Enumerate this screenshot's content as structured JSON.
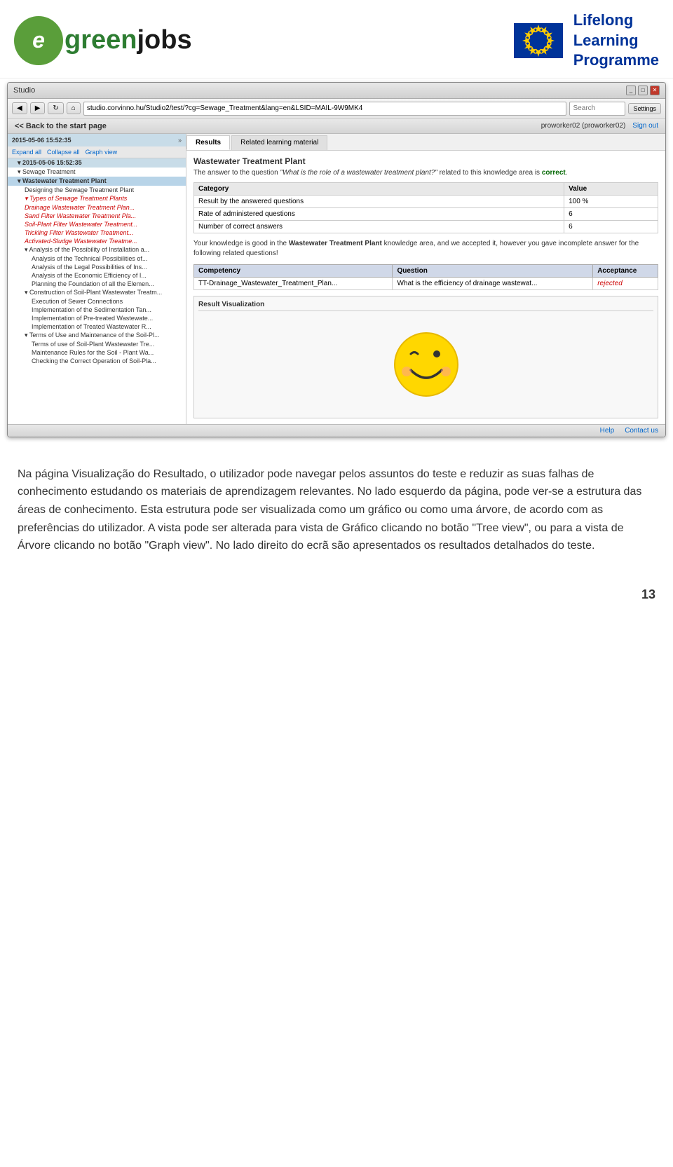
{
  "header": {
    "logo_e": "e",
    "logo_green": "green",
    "logo_jobs": "jobs",
    "lifelong_line1": "Lifelong",
    "lifelong_line2": "Learning",
    "lifelong_line3": "Programme"
  },
  "browser": {
    "title": "Studio",
    "title_full": "Studio",
    "address": "studio.corvinno.hu/Studio2/test/?cg=Sewage_Treatment&lang=en&LSID=MAIL-9W9MK4",
    "settings_label": "Settings",
    "user": "proworker02 (proworker02)",
    "sign_out": "Sign out",
    "back_link": "<< Back to the start page",
    "timestamp": "2015-05-06 15:52:35",
    "timestamp2": "2015-05-06 15:52:35"
  },
  "sidebar": {
    "controls": {
      "expand_all": "Expand all",
      "collapse_all": "Collapse all",
      "graph_view": "Graph view"
    },
    "items": [
      {
        "label": "Sewage Treatment",
        "level": "level0"
      },
      {
        "label": "▾ Wastewater Treatment Plant",
        "level": "level1 selected"
      },
      {
        "label": "Designing the Sewage Treatment Plant",
        "level": "level2b"
      },
      {
        "label": "▾ Types of Sewage Treatment Plants",
        "level": "level2"
      },
      {
        "label": "Drainage Wastewater Treatment Plan...",
        "level": "level2"
      },
      {
        "label": "Sand Filter Wastewater Treatment Plan...",
        "level": "level2"
      },
      {
        "label": "Soil-Plant Filter Wastewater Treatment...",
        "level": "level2"
      },
      {
        "label": "Trickling Filter Wastewater Treatment...",
        "level": "level2"
      },
      {
        "label": "Activated-Sludge Wastewater Treatme...",
        "level": "level2"
      },
      {
        "label": "▾ Analysis of the Possibility of Installation a...",
        "level": "level2b"
      },
      {
        "label": "Analysis of the Technical Possibilities of...",
        "level": "level3b"
      },
      {
        "label": "Analysis of the Legal Possibilities of Ins...",
        "level": "level3b"
      },
      {
        "label": "Analysis of the Economic Efficiency of I...",
        "level": "level3b"
      },
      {
        "label": "Planning the Foundation of all the Elemen...",
        "level": "level3b"
      },
      {
        "label": "▾ Construction of Soil-Plant Wastewater Treatm...",
        "level": "level2b"
      },
      {
        "label": "Execution of Sewer Connections",
        "level": "level3b"
      },
      {
        "label": "Implementation of the Sedimentation Tan...",
        "level": "level3b"
      },
      {
        "label": "Implementation of Pre-treated Wastewate...",
        "level": "level3b"
      },
      {
        "label": "Implementation of Treated Wastewater R...",
        "level": "level3b"
      },
      {
        "label": "▾ Terms of Use and Maintenance of the Soil-Pl...",
        "level": "level2b"
      },
      {
        "label": "Terms of use of Soil-Plant Wastewater Tre...",
        "level": "level3b"
      },
      {
        "label": "Maintenance Rules for the Soil - Plant Wa...",
        "level": "level3b"
      },
      {
        "label": "Checking the Correct Operation of Soil-Pla...",
        "level": "level3b"
      }
    ]
  },
  "tabs": [
    {
      "label": "Results",
      "active": true
    },
    {
      "label": "Related learning material",
      "active": false
    }
  ],
  "result": {
    "title": "Wastewater Treatment Plant",
    "question_prefix": "The answer to the question",
    "question_text": "\"What is the role of a wastewater treatment plant?\"",
    "question_suffix": "related to this knowledge area is",
    "question_result": "correct",
    "table": {
      "headers": [
        "Category",
        "Value"
      ],
      "rows": [
        [
          "Result by the answered questions",
          "100 %"
        ],
        [
          "Rate of administered questions",
          "6"
        ],
        [
          "Number of correct answers",
          "6"
        ]
      ]
    },
    "message": "Your knowledge is good in the Wastewater Treatment Plant knowledge area, and we accepted it, however you gave incomplete answer for the following related questions!",
    "competency_headers": [
      "Competency",
      "Question",
      "Acceptance"
    ],
    "competency_rows": [
      [
        "TT-Drainage_Wastewater_Treatment_Plan...",
        "What is the efficiency of drainage wastewat...",
        "rejected"
      ]
    ],
    "visualization_title": "Result Visualization"
  },
  "footer_links": [
    "Help",
    "Contact us"
  ],
  "body_paragraphs": [
    "Na página Visualização do Resultado, o utilizador pode navegar pelos assuntos do teste e reduzir as suas falhas de conhecimento estudando os materiais de aprendizagem relevantes. No lado esquerdo da página, pode ver-se a estrutura das áreas de conhecimento. Esta estrutura pode ser visualizada como um gráfico ou como uma árvore, de acordo com as preferências do utilizador. A vista pode ser alterada para vista de Gráfico clicando no botão \"Tree view\", ou para a vista de Árvore clicando no botão \"Graph view\". No lado direito do ecrã são apresentados os resultados detalhados do teste."
  ],
  "page_number": "13"
}
